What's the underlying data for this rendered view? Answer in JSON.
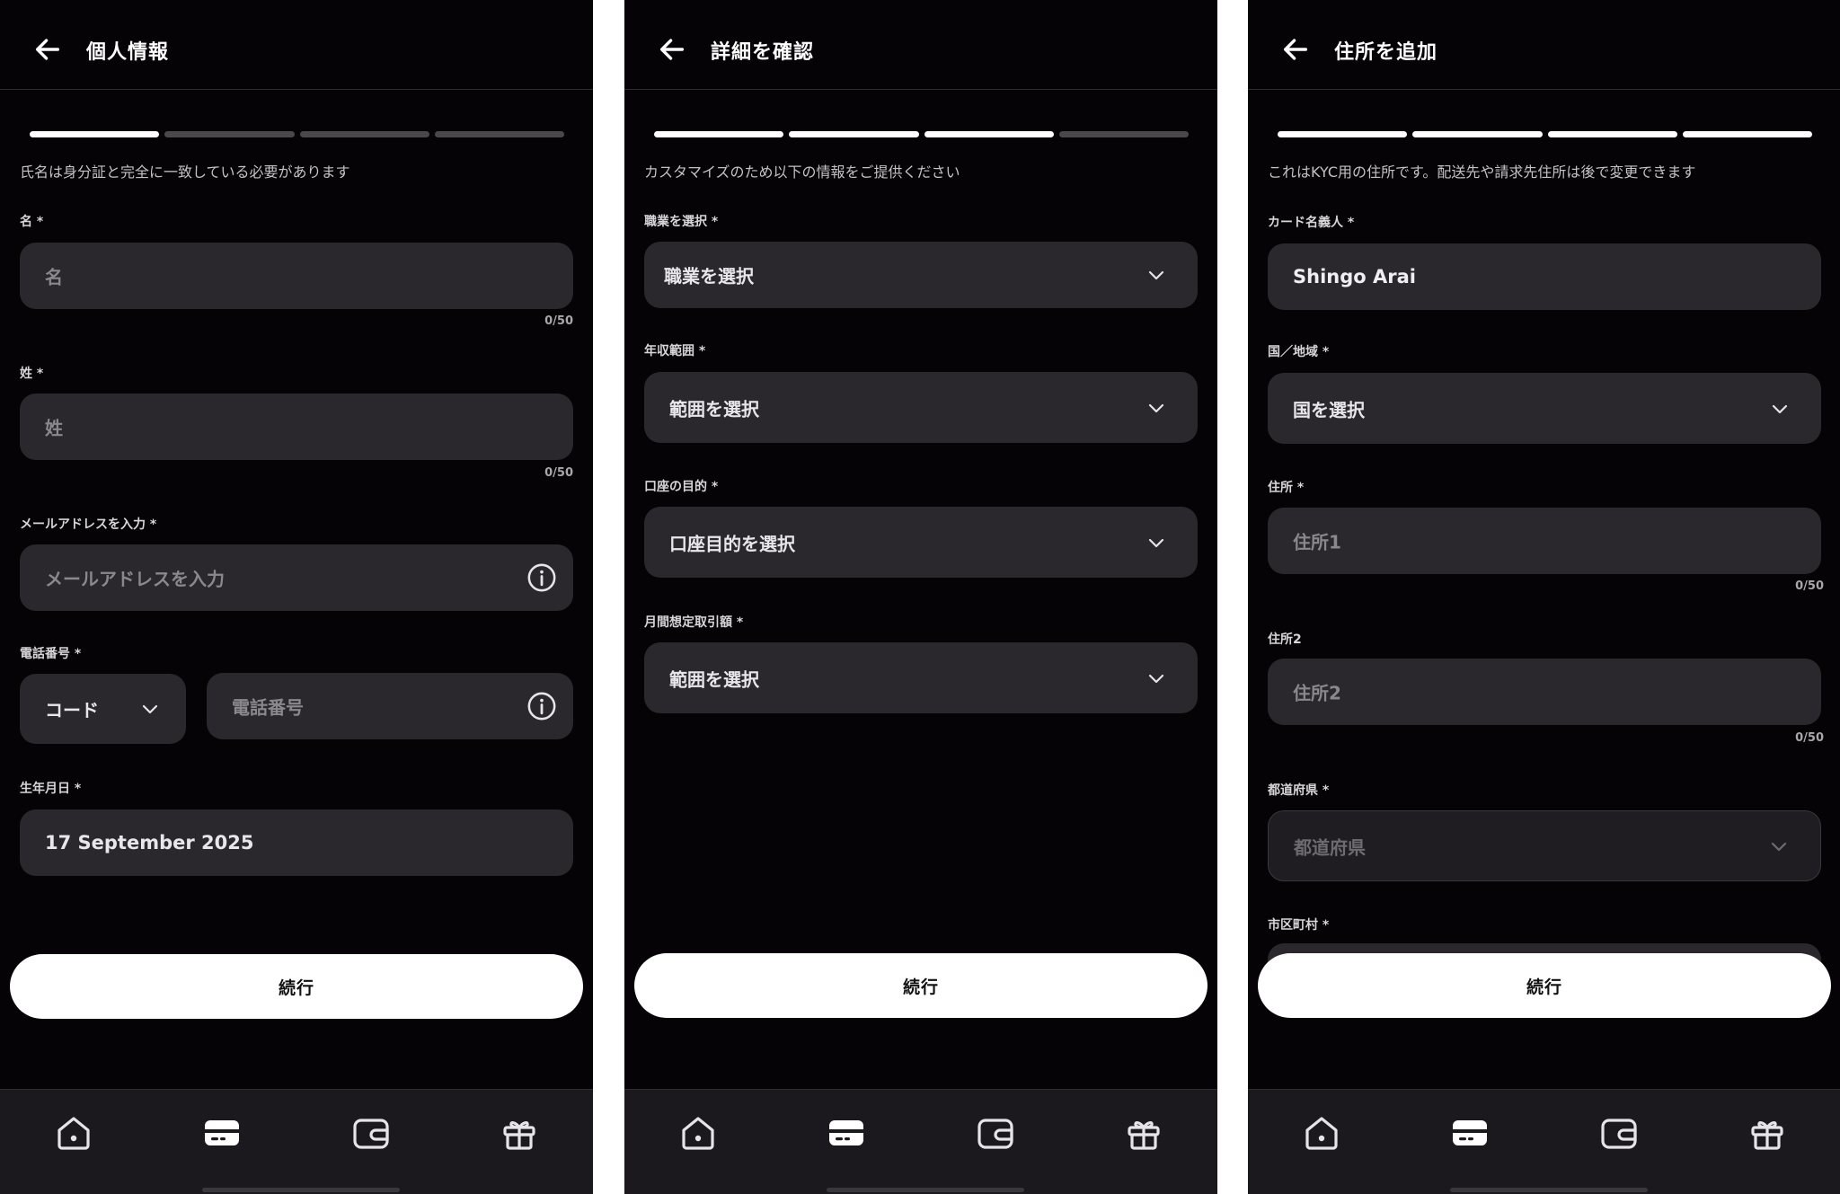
{
  "screens": [
    {
      "title": "個人情報",
      "progress": [
        true,
        false,
        false,
        false
      ],
      "subtitle": "氏名は身分証と完全に一致している必要があります",
      "first_name": {
        "label": "名 *",
        "placeholder": "名",
        "counter": "0/50"
      },
      "last_name": {
        "label": "姓 *",
        "placeholder": "姓",
        "counter": "0/50"
      },
      "email": {
        "label": "メールアドレスを入力 *",
        "placeholder": "メールアドレスを入力"
      },
      "phone": {
        "label": "電話番号 *",
        "code_value": "コード",
        "placeholder": "電話番号"
      },
      "dob": {
        "label": "生年月日 *",
        "value": "17 September 2025"
      },
      "continue_label": "続行"
    },
    {
      "title": "詳細を確認",
      "progress": [
        true,
        true,
        true,
        false
      ],
      "subtitle": "カスタマイズのため以下の情報をご提供ください",
      "occupation": {
        "label": "職業を選択 *",
        "value": "職業を選択"
      },
      "income": {
        "label": "年収範囲 *",
        "value": "範囲を選択"
      },
      "purpose": {
        "label": "口座の目的 *",
        "value": "口座目的を選択"
      },
      "monthly": {
        "label": "月間想定取引額 *",
        "value": "範囲を選択"
      },
      "continue_label": "続行"
    },
    {
      "title": "住所を追加",
      "progress": [
        true,
        true,
        true,
        true
      ],
      "subtitle": "これはKYC用の住所です。配送先や請求先住所は後で変更できます",
      "cardholder": {
        "label": "カード名義人 *",
        "value": "Shingo Arai"
      },
      "country": {
        "label": "国／地域 *",
        "value": "国を選択"
      },
      "address1": {
        "label": "住所 *",
        "placeholder": "住所1",
        "counter": "0/50"
      },
      "address2": {
        "label": "住所2",
        "placeholder": "住所2",
        "counter": "0/50"
      },
      "prefecture": {
        "label": "都道府県 *",
        "placeholder": "都道府県"
      },
      "city": {
        "label": "市区町村 *"
      },
      "continue_label": "続行"
    }
  ],
  "tabbar": [
    "home-icon",
    "card-icon",
    "wallet-icon",
    "gift-icon"
  ],
  "colors": {
    "background": "#050305",
    "field": "#2a282d",
    "accent": "#ffffff",
    "tabbar": "#1b191d"
  }
}
